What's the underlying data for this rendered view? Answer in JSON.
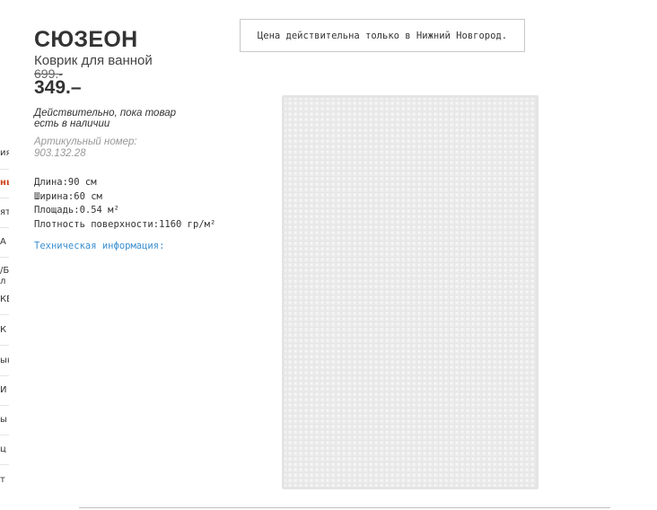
{
  "background_nav": {
    "fragments": [
      "ия",
      "ны",
      "ят",
      "А",
      "/Б",
      "л",
      "КЕ",
      "К",
      "ын",
      "И",
      "ы",
      "ц",
      "т"
    ]
  },
  "product": {
    "name": "СЮЗЕОН",
    "subtitle": "Коврик для ванной",
    "old_price": "699.-",
    "price": "349.–",
    "availability": "Действительно, пока товар есть в наличии",
    "article": "Артикульный номер: 903.132.28",
    "specs": [
      "Длина:90 см",
      "Ширина:60 см",
      "Площадь:0.54 м²",
      "Плотность поверхности:1160 гр/м²"
    ],
    "tech_info_link": "Техническая информация:",
    "image_icon": "bath-mat-photo"
  },
  "notice": {
    "text": "Цена действительна только в Нижний Новгород."
  },
  "colors": {
    "link": "#3a8fd1",
    "accent": "#d0461c"
  }
}
